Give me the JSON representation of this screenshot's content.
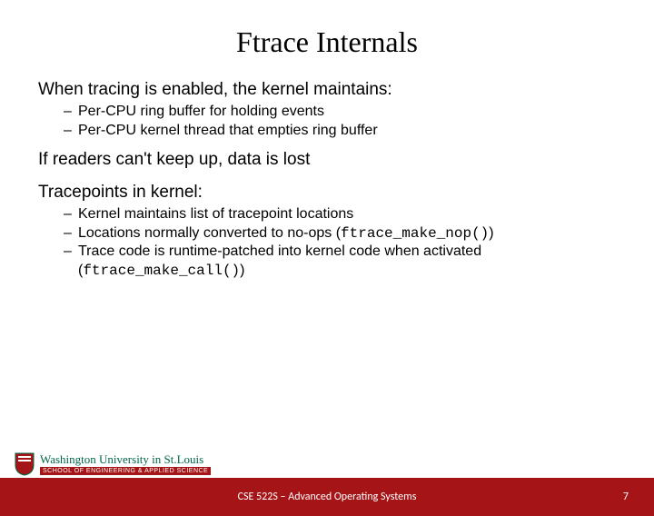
{
  "title": "Ftrace Internals",
  "sections": [
    {
      "lead": "When tracing is enabled, the kernel maintains:",
      "items": [
        "Per-CPU ring buffer for holding events",
        "Per-CPU kernel thread that empties ring buffer"
      ]
    },
    {
      "lead": "If readers can't keep up, data is lost",
      "items": []
    },
    {
      "lead": "Tracepoints in kernel:",
      "items": [
        "Kernel maintains list of tracepoint locations",
        "Locations normally converted to no-ops (ftrace_make_nop())",
        "Trace code is runtime-patched into kernel code when activated (ftrace_make_call())"
      ]
    }
  ],
  "logo": {
    "university": "Washington University in St.Louis",
    "school": "SCHOOL OF ENGINEERING & APPLIED SCIENCE"
  },
  "footer": {
    "course": "CSE 522S – Advanced Operating Systems",
    "page": "7"
  }
}
